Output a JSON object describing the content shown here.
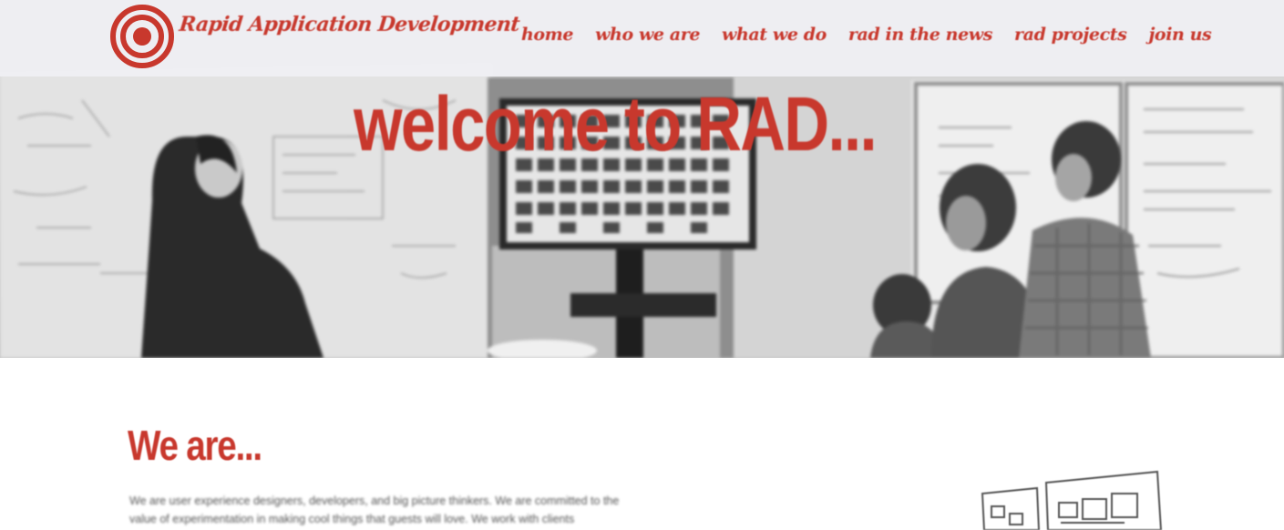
{
  "brand": {
    "name": "Rapid Application Development",
    "accent_color": "#c8382d",
    "logo_icon": "target-icon"
  },
  "nav": {
    "items": [
      {
        "label": "home"
      },
      {
        "label": "who we are"
      },
      {
        "label": "what we do"
      },
      {
        "label": "rad in the news"
      },
      {
        "label": "rad projects"
      },
      {
        "label": "join us"
      }
    ]
  },
  "hero": {
    "title": "welcome to RAD..."
  },
  "about": {
    "heading": "We are...",
    "body": "We are user experience designers, developers, and big picture thinkers. We are committed to the value of experimentation in making cool things that guests will love. We work with clients"
  }
}
